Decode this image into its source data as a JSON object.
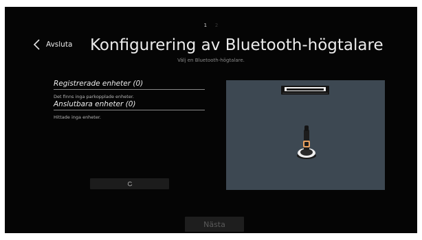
{
  "stepper": {
    "steps": [
      "1",
      "2"
    ],
    "active_step": "1"
  },
  "header": {
    "back_label": "Avsluta",
    "title": "Konfigurering av Bluetooth-högtalare",
    "subtitle": "Välj en Bluetooth-högtalare."
  },
  "registered_devices": {
    "heading": "Registrerade enheter (0)",
    "empty_message": "Det finns inga parkopplade enheter."
  },
  "connectable_devices": {
    "heading": "Anslutbara enheter (0)",
    "empty_message": "Hittade inga enheter."
  },
  "actions": {
    "next_label": "Nästa"
  },
  "icons": {
    "back": "chevron-left-icon",
    "refresh": "refresh-icon",
    "soundbar": "soundbar-icon",
    "remote": "remote-control-icon"
  },
  "colors": {
    "screen_background": "#050505",
    "illustration_background": "#3d4852",
    "button_background": "#1e1e1e",
    "disabled_text": "#5a5a5a"
  }
}
